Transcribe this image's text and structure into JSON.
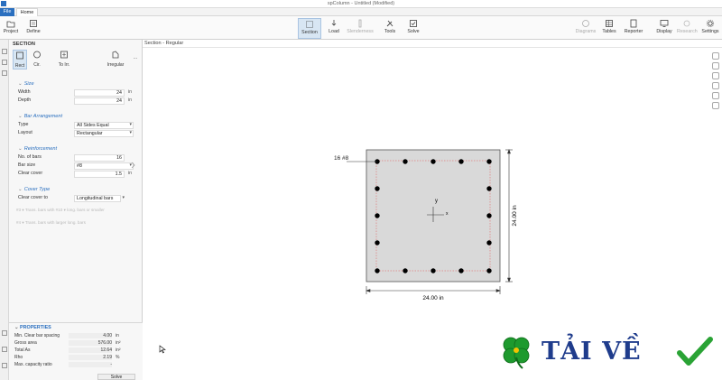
{
  "window": {
    "title": "spColumn - Untitled (Modified)"
  },
  "tabs": {
    "file": "File",
    "home": "Home"
  },
  "ribbon": {
    "project": "Project",
    "define": "Define",
    "section": "Section",
    "load": "Load",
    "slenderness": "Slenderness",
    "tools": "Tools",
    "solve": "Solve",
    "diagrams": "Diagrams",
    "tables": "Tables",
    "reporter": "Reporter",
    "display": "Display",
    "ribbon_right_dim": "Research",
    "settings": "Settings"
  },
  "panel": {
    "title": "SECTION",
    "shapes": {
      "rect": "Rect",
      "circ": "Cir.",
      "to_irr": "To Irr.",
      "irregular": "Irregular",
      "more": "..."
    },
    "size": {
      "title": "Size",
      "width_label": "Width",
      "width_value": "24",
      "width_unit": "in",
      "depth_label": "Depth",
      "depth_value": "24",
      "depth_unit": "in"
    },
    "bar_arrangement": {
      "title": "Bar Arrangement",
      "type_label": "Type",
      "type_value": "All Sides Equal",
      "layout_label": "Layout",
      "layout_value": "Rectangular"
    },
    "reinforcement": {
      "title": "Reinforcement",
      "bars_label": "No. of bars",
      "bars_value": "16",
      "size_label": "Bar size",
      "size_value": "#8",
      "cover_label": "Clear cover",
      "cover_value": "1.5",
      "cover_unit": "in"
    },
    "cover_type": {
      "title": "Cover Type",
      "clear_label": "Clear cover to",
      "clear_value": "Longitudinal bars"
    },
    "ghost1": "#3  ▾  Trans. bars with  #10  ▾  long. bars or smaller",
    "ghost2": "#4  ▾  Trans. bars with larger long. bars"
  },
  "properties": {
    "title": "PROPERTIES",
    "rows": [
      {
        "label": "Min. Clear bar spacing",
        "value": "4.00",
        "unit": "in"
      },
      {
        "label": "Gross area",
        "value": "576.00",
        "unit": "in²"
      },
      {
        "label": "Total As",
        "value": "12.64",
        "unit": "in²"
      },
      {
        "label": "Rho",
        "value": "2.19",
        "unit": "%"
      },
      {
        "label": "Max. capacity ratio",
        "value": "-",
        "unit": ""
      }
    ],
    "solve": "Solve"
  },
  "canvas": {
    "title": "Section - Regular",
    "bar_label": "16 #8",
    "width_dim": "24.00 in",
    "depth_dim": "24.00 in",
    "axis_y": "y",
    "axis_x": "x"
  },
  "watermark": {
    "text": "TẢI VỀ"
  },
  "colors": {
    "accent": "#2a6fbf",
    "section_fill": "#d9d9d9",
    "cover_line": "#e05555"
  }
}
